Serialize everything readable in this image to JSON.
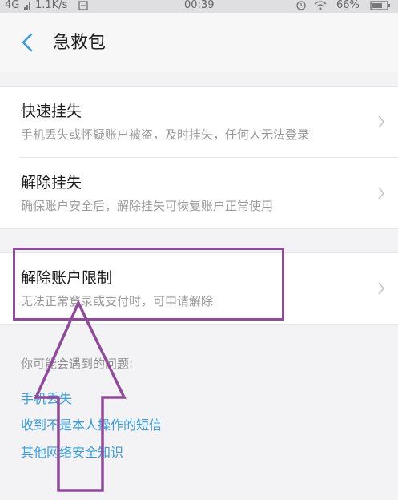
{
  "status_bar": {
    "network": "4G",
    "speed": "1.1K/s",
    "time": "00:39",
    "battery": "66%"
  },
  "nav": {
    "title": "急救包"
  },
  "menu": {
    "items": [
      {
        "title": "快速挂失",
        "desc": "手机丢失或怀疑账户被盗，及时挂失，任何人无法登录"
      },
      {
        "title": "解除挂失",
        "desc": "确保账户安全后，解除挂失可恢复账户正常使用"
      },
      {
        "title": "解除账户限制",
        "desc": "无法正常登录或支付时，可申请解除"
      }
    ]
  },
  "faq": {
    "heading": "你可能会遇到的问题:",
    "links": [
      "手机丢失",
      "收到不是本人操作的短信",
      "其他网络安全知识"
    ]
  },
  "annotation": {
    "color": "#8f4a9a"
  },
  "colors": {
    "link": "#3a9bd6",
    "back_icon": "#3a9bd6"
  },
  "icons": [
    "back-arrow-icon",
    "chevron-right-icon",
    "wifi-icon",
    "alarm-icon",
    "battery-icon",
    "signal-icon"
  ]
}
